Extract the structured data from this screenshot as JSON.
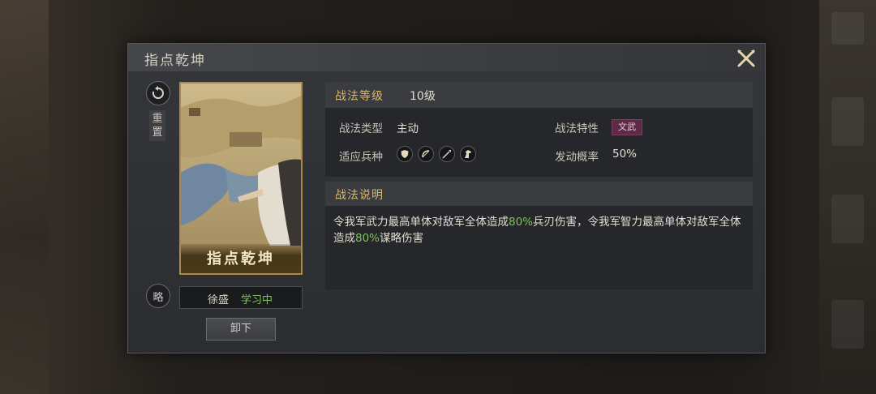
{
  "dialog": {
    "title": "指点乾坤",
    "close_icon": "close-x-icon"
  },
  "left": {
    "reset_label": "重置",
    "reset_icon": "undo-arrow-icon",
    "strategy_label": "略",
    "card_name": "指点乾坤",
    "learner_name": "徐盛",
    "learner_status": "学习中",
    "unload_label": "卸下"
  },
  "attributes": {
    "level_label": "战法等级",
    "level_value": "10级",
    "type_label": "战法类型",
    "type_value": "主动",
    "trait_label": "战法特性",
    "trait_value": "文武",
    "troop_label": "适应兵种",
    "troop_icons": [
      "shield-icon",
      "bow-icon",
      "spear-icon",
      "horse-icon"
    ],
    "rate_label": "发动概率",
    "rate_value": "50%"
  },
  "description": {
    "label": "战法说明",
    "part1": "令我军武力最高单体对敌军全体造成",
    "pct1": "80%",
    "part2": "兵刃伤害，令我军智力最高单体对敌军全体造成",
    "pct2": "80%",
    "part3": "谋略伤害"
  },
  "colors": {
    "accent_gold": "#d9b86a",
    "highlight_green": "#7fc45e",
    "trait_badge": "#5e2a47"
  }
}
